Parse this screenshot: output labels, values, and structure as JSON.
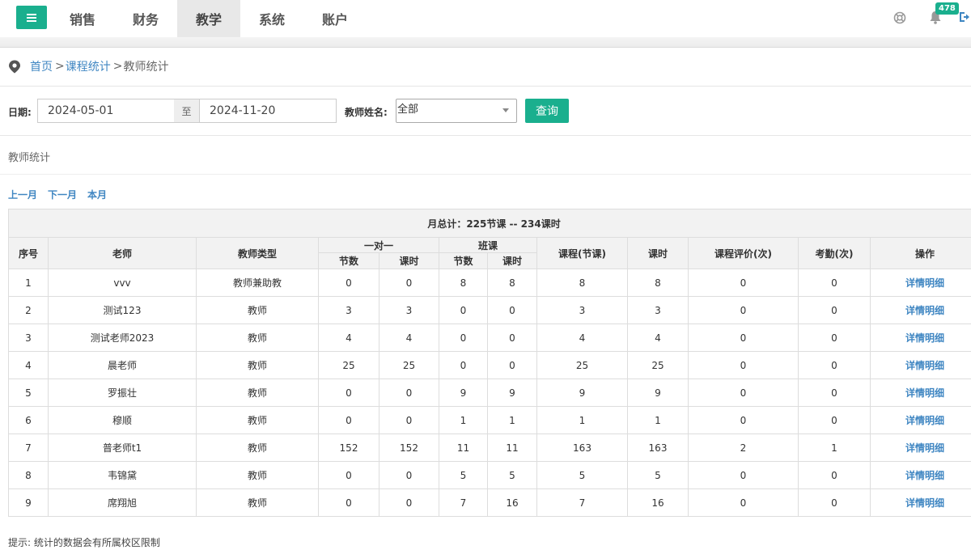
{
  "nav": {
    "items": [
      {
        "label": "销售",
        "active": false
      },
      {
        "label": "财务",
        "active": false
      },
      {
        "label": "教学",
        "active": true
      },
      {
        "label": "系统",
        "active": false
      },
      {
        "label": "账户",
        "active": false
      }
    ],
    "notification_count": "478"
  },
  "breadcrumb": {
    "home": "首页",
    "sep1": ">",
    "course_stats": "课程统计",
    "sep2": ">",
    "current": "教师统计"
  },
  "filter": {
    "date_label": "日期:",
    "date_from": "2024-05-01",
    "to_label": "至",
    "date_to": "2024-11-20",
    "teacher_label": "教师姓名:",
    "teacher_selected": "全部",
    "query_label": "查询"
  },
  "section_title": "教师统计",
  "month_links": {
    "prev": "上一月",
    "next": "下一月",
    "current": "本月"
  },
  "table": {
    "total": "月总计：225节课 -- 234课时",
    "headers": {
      "index": "序号",
      "teacher": "老师",
      "type": "教师类型",
      "one_on_one": "一对一",
      "class": "班课",
      "sessions": "节数",
      "hours": "课时",
      "course_sessions": "课程(节课)",
      "course_hours": "课时",
      "evaluations": "课程评价(次)",
      "attendance": "考勤(次)",
      "action": "操作"
    },
    "rows": [
      {
        "index": "1",
        "teacher": "vvv",
        "type": "教师兼助教",
        "o_sessions": "0",
        "o_hours": "0",
        "c_sessions": "8",
        "c_hours": "8",
        "course_sessions": "8",
        "course_hours": "8",
        "evaluations": "0",
        "attendance": "0",
        "action": "详情明细"
      },
      {
        "index": "2",
        "teacher": "测试123",
        "type": "教师",
        "o_sessions": "3",
        "o_hours": "3",
        "c_sessions": "0",
        "c_hours": "0",
        "course_sessions": "3",
        "course_hours": "3",
        "evaluations": "0",
        "attendance": "0",
        "action": "详情明细"
      },
      {
        "index": "3",
        "teacher": "测试老师2023",
        "type": "教师",
        "o_sessions": "4",
        "o_hours": "4",
        "c_sessions": "0",
        "c_hours": "0",
        "course_sessions": "4",
        "course_hours": "4",
        "evaluations": "0",
        "attendance": "0",
        "action": "详情明细"
      },
      {
        "index": "4",
        "teacher": "晨老师",
        "type": "教师",
        "o_sessions": "25",
        "o_hours": "25",
        "c_sessions": "0",
        "c_hours": "0",
        "course_sessions": "25",
        "course_hours": "25",
        "evaluations": "0",
        "attendance": "0",
        "action": "详情明细"
      },
      {
        "index": "5",
        "teacher": "罗振壮",
        "type": "教师",
        "o_sessions": "0",
        "o_hours": "0",
        "c_sessions": "9",
        "c_hours": "9",
        "course_sessions": "9",
        "course_hours": "9",
        "evaluations": "0",
        "attendance": "0",
        "action": "详情明细"
      },
      {
        "index": "6",
        "teacher": "穆顺",
        "type": "教师",
        "o_sessions": "0",
        "o_hours": "0",
        "c_sessions": "1",
        "c_hours": "1",
        "course_sessions": "1",
        "course_hours": "1",
        "evaluations": "0",
        "attendance": "0",
        "action": "详情明细"
      },
      {
        "index": "7",
        "teacher": "普老师t1",
        "type": "教师",
        "o_sessions": "152",
        "o_hours": "152",
        "c_sessions": "11",
        "c_hours": "11",
        "course_sessions": "163",
        "course_hours": "163",
        "evaluations": "2",
        "attendance": "1",
        "action": "详情明细"
      },
      {
        "index": "8",
        "teacher": "韦锦黛",
        "type": "教师",
        "o_sessions": "0",
        "o_hours": "0",
        "c_sessions": "5",
        "c_hours": "5",
        "course_sessions": "5",
        "course_hours": "5",
        "evaluations": "0",
        "attendance": "0",
        "action": "详情明细"
      },
      {
        "index": "9",
        "teacher": "席翔旭",
        "type": "教师",
        "o_sessions": "0",
        "o_hours": "0",
        "c_sessions": "7",
        "c_hours": "16",
        "course_sessions": "7",
        "course_hours": "16",
        "evaluations": "0",
        "attendance": "0",
        "action": "详情明细"
      }
    ]
  },
  "tip": "提示: 统计的数据会有所属校区限制",
  "colors": {
    "accent": "#1aaf8e",
    "link": "#3f86c2"
  },
  "icons": [
    "menu-icon",
    "help-icon",
    "bell-icon",
    "logout-icon",
    "location-pin-icon",
    "dropdown-caret-icon"
  ]
}
